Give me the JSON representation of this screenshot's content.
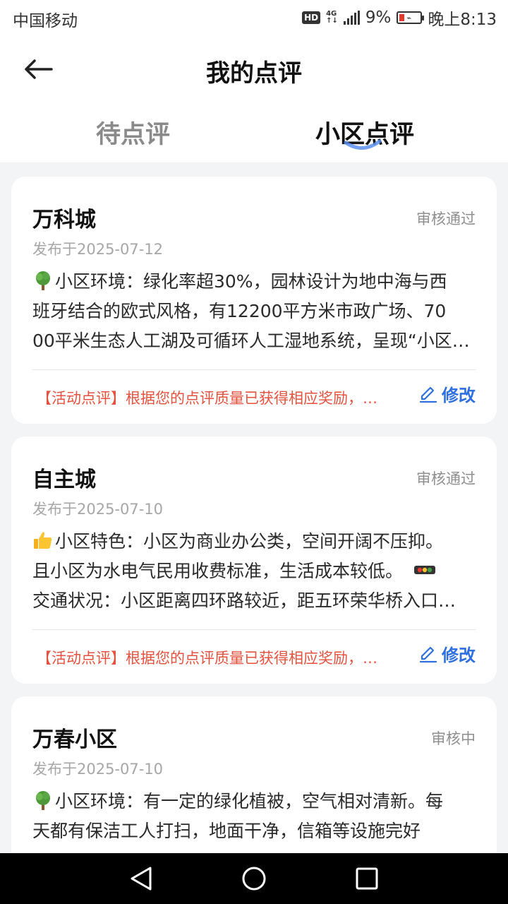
{
  "status_bar": {
    "carrier": "中国移动",
    "hd": "HD",
    "net_top": "4G",
    "net_bottom": "↑↓",
    "battery": "9%",
    "time": "晚上8:13"
  },
  "header": {
    "title": "我的点评",
    "back_icon": "arrow-left-icon"
  },
  "tabs": [
    {
      "label": "待点评",
      "active": false
    },
    {
      "label": "小区点评",
      "active": true
    }
  ],
  "colors": {
    "accent": "#2f6fe0",
    "promo": "#e4523e",
    "status_text": "#8e8e8e",
    "page_bg": "#f3f4f6"
  },
  "reviews": [
    {
      "title": "万科城",
      "status": "审核通过",
      "date": "发布于2025-07-12",
      "body_lines": [
        "小区环境：绿化率超30%，园林设计为地中海与西",
        "班牙结合的欧式风格，有12200平方米市政广场、70",
        "00平米生态人工湖及可循环人工湿地系统，呈现“小区…"
      ],
      "emoji": "tree-icon",
      "promo": "【活动点评】根据您的点评质量已获得相应奖励，请查看",
      "edit_label": "修改"
    },
    {
      "title": "自主城",
      "status": "审核通过",
      "date": "发布于2025-07-10",
      "body_lines": [
        "小区特色：小区为商业办公类，空间开阔不压抑。",
        "且小区为水电气民用收费标准，生活成本较低。",
        "交通状况：小区距离四环路较近，距五环荣华桥入口…"
      ],
      "emoji": "thumbs-up-icon",
      "inline_emoji": "traffic-light-icon",
      "promo": "【活动点评】根据您的点评质量已获得相应奖励，请查看",
      "edit_label": "修改"
    },
    {
      "title": "万春小区",
      "status": "审核中",
      "date": "发布于2025-07-10",
      "body_lines": [
        "小区环境：有一定的绿化植被，空气相对清新。每",
        "天都有保洁工人打扫，地面干净，信箱等设施完好"
      ],
      "emoji": "tree-icon"
    }
  ],
  "nav_bar": {
    "back": "triangle-back-icon",
    "home": "circle-home-icon",
    "recents": "square-recents-icon"
  }
}
